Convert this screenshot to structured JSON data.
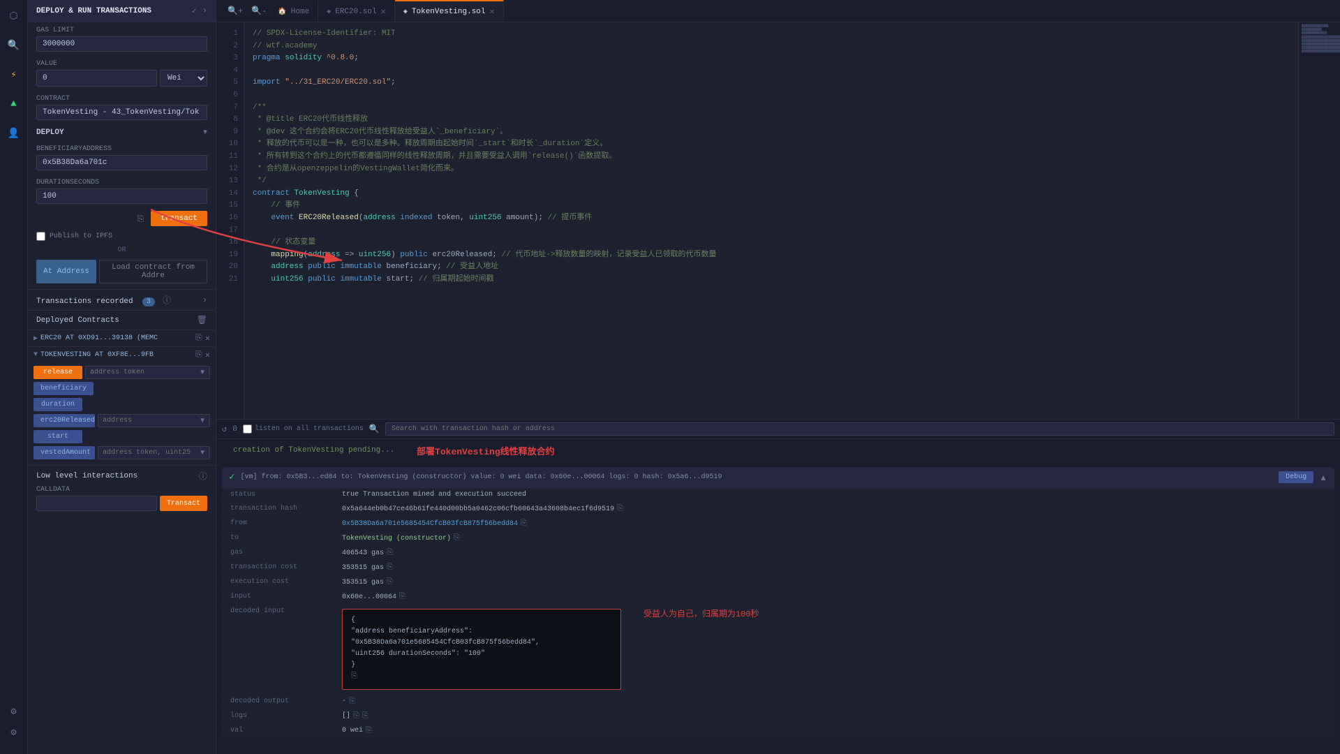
{
  "app": {
    "title": "DEPLOY & RUN TRANSACTIONS"
  },
  "sidebar": {
    "icons": [
      "⬡",
      "🔍",
      "⚡",
      "▶",
      "👤",
      "⚙"
    ]
  },
  "deploy_panel": {
    "header": {
      "title": "DEPLOY & RUN TRANSACTIONS",
      "check_icon": "✓",
      "arrow_icon": "›"
    },
    "gas_limit_label": "GAS LIMIT",
    "gas_limit_value": "3000000",
    "value_label": "VALUE",
    "value_amount": "0",
    "value_unit": "Wei",
    "contract_label": "CONTRACT",
    "contract_value": "TokenVesting - 43_TokenVesting/Tok",
    "deploy_label": "DEPLOY",
    "beneficiary_label": "BENEFICIARYADDRESS",
    "beneficiary_value": "0x5B38Da6a701c",
    "duration_label": "DURATIONSECONDS",
    "duration_value": "100",
    "transact_btn": "transact",
    "publish_ipfs": "Publish to IPFS",
    "or_text": "OR",
    "at_address_btn": "At Address",
    "load_contract_btn": "Load contract from Addre",
    "transactions_title": "Transactions recorded",
    "transactions_count": "3",
    "deployed_contracts_title": "Deployed Contracts",
    "erc20_contract": "ERC20 AT 0XD91...39138 (MEMC",
    "tokenvesting_contract": "TOKENVESTING AT 0XF8E...9FB",
    "release_btn": "release",
    "release_input_placeholder": "address token",
    "beneficiary_btn": "beneficiary",
    "duration_btn": "duration",
    "erc20released_btn": "erc20Released",
    "erc20released_placeholder": "address",
    "start_btn": "start",
    "vested_btn": "vestedAmount",
    "vested_placeholder": "address token, uint256",
    "low_level_title": "Low level interactions",
    "calldata_label": "CALLDATA",
    "transact_small_btn": "Transact"
  },
  "editor": {
    "tabs": [
      {
        "id": "home",
        "label": "Home",
        "icon": "🏠",
        "active": false,
        "closeable": false
      },
      {
        "id": "erc20",
        "label": "ERC20.sol",
        "icon": "◈",
        "active": false,
        "closeable": true
      },
      {
        "id": "tokenvesting",
        "label": "TokenVesting.sol",
        "icon": "◈",
        "active": true,
        "closeable": true
      }
    ],
    "lines": [
      {
        "num": 1,
        "code": "// SPDX-License-Identifier: MIT",
        "class": "c-comment"
      },
      {
        "num": 2,
        "code": "// wtf.academy",
        "class": "c-comment"
      },
      {
        "num": 3,
        "code": "pragma solidity ^0.8.0;",
        "class": "c-default"
      },
      {
        "num": 4,
        "code": "",
        "class": "c-default"
      },
      {
        "num": 5,
        "code": "import \"../31_ERC20/ERC20.sol\";",
        "class": "c-default"
      },
      {
        "num": 6,
        "code": "",
        "class": "c-default"
      },
      {
        "num": 7,
        "code": "/**",
        "class": "c-comment"
      },
      {
        "num": 8,
        "code": " * @title ERC20代币线性释放",
        "class": "c-comment"
      },
      {
        "num": 9,
        "code": " * @dev 这个合约会将ERC20代币线性释放给受益人`_beneficiary`。",
        "class": "c-comment"
      },
      {
        "num": 10,
        "code": " * 释放的代币可以是一种，也可以是多种。释放周期由起始时间`_start`和时长`_duration`定义。",
        "class": "c-comment"
      },
      {
        "num": 11,
        "code": " * 所有转到这个合约上的代币都遵循同样的线性释放周期，并且需要受益人调用`release()`函数提取。",
        "class": "c-comment"
      },
      {
        "num": 12,
        "code": " * 合约是从openzeppelin的VestingWallet简化而来。",
        "class": "c-comment"
      },
      {
        "num": 13,
        "code": " */",
        "class": "c-comment"
      },
      {
        "num": 14,
        "code": "contract TokenVesting {",
        "class": "c-default"
      },
      {
        "num": 15,
        "code": "    // 事件",
        "class": "c-comment"
      },
      {
        "num": 16,
        "code": "    event ERC20Released(address indexed token, uint256 amount); // 提币事件",
        "class": "c-default"
      },
      {
        "num": 17,
        "code": "",
        "class": "c-default"
      },
      {
        "num": 18,
        "code": "    // 状态变量",
        "class": "c-comment"
      },
      {
        "num": 19,
        "code": "    mapping(address => uint256) public erc20Released; // 代币地址->释放数量的映射，记录受益人已领取的代币数量",
        "class": "c-default"
      },
      {
        "num": 20,
        "code": "    address public immutable beneficiary; // 受益人地址",
        "class": "c-default"
      },
      {
        "num": 21,
        "code": "    uint256 public immutable start; // 归属期起始时间戳",
        "class": "c-default"
      }
    ]
  },
  "tx_area": {
    "count": "0",
    "listen_all": "listen on all transactions",
    "search_placeholder": "Search with transaction hash or address",
    "creation_notice": "creation of TokenVesting pending...",
    "annotation_deploy": "部署TokenVesting线性释放合约",
    "transaction": {
      "status_icon": "✓",
      "summary": "[vm] from: 0x5B3...ed84 to: TokenVesting (constructor) value: 0 wei data: 0x60e...00064 logs: 0 hash: 0x5a6...d9519",
      "debug_btn": "Debug",
      "status_label": "status",
      "status_value": "true Transaction mined and execution succeed",
      "tx_hash_label": "transaction hash",
      "tx_hash_value": "0x5a644eb0b47ce46b61fe440d00bb5a0462c06cfb60643a43608b4ec1f6d9519",
      "from_label": "from",
      "from_value": "0x5B38Da6a701e5685454CfcB03fcB875f56bedd84",
      "to_label": "to",
      "to_value": "TokenVesting (constructor)",
      "gas_label": "gas",
      "gas_value": "406543 gas",
      "tx_cost_label": "transaction cost",
      "tx_cost_value": "353515 gas",
      "exec_cost_label": "execution cost",
      "exec_cost_value": "353515 gas",
      "input_label": "input",
      "input_value": "0x60e...00064",
      "decoded_input_label": "decoded input",
      "decoded_input_value": "{\n    \"address beneficiaryAddress\": \"0x5B38Da6a701e5685454CfcB03fcB875f56bedd84\",\n    \"uint256 durationSeconds\": \"100\"\n}",
      "decoded_output_label": "decoded output",
      "decoded_output_value": "-",
      "logs_label": "logs",
      "logs_value": "[]",
      "val_label": "val",
      "val_value": "0 wei"
    },
    "annotation_self": "受益人为自己，归属期为100秒"
  }
}
